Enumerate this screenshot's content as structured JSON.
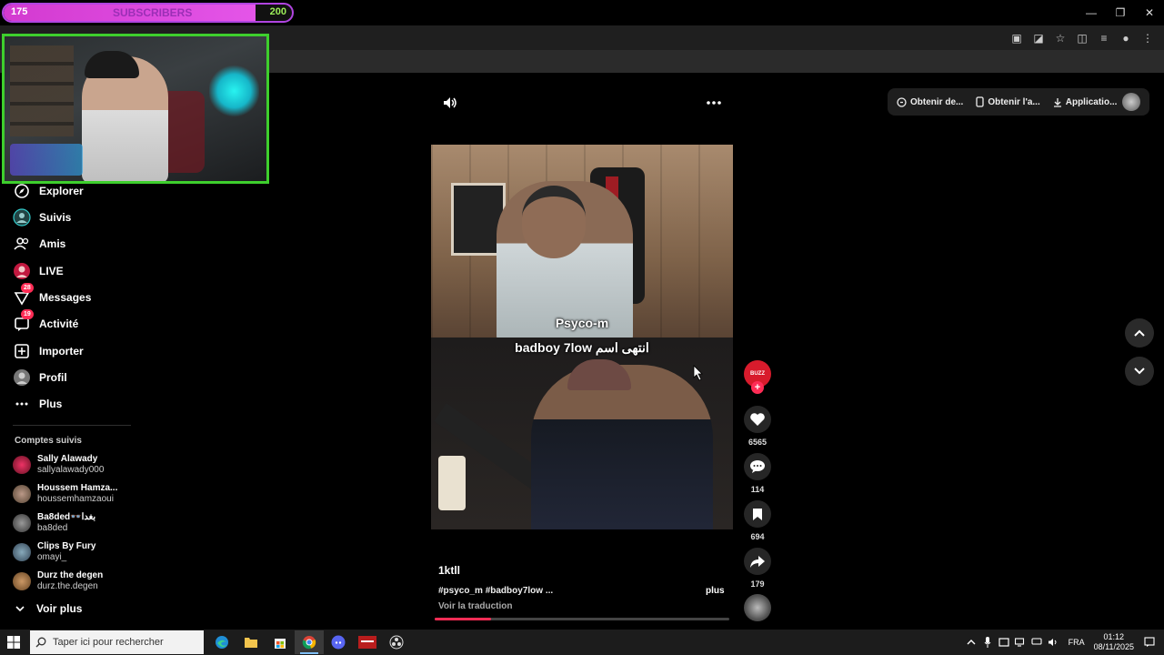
{
  "overlay": {
    "subscribers": {
      "current": "175",
      "label": "SUBSCRIBERS",
      "goal": "200",
      "progress": 0.875,
      "bar_color": "#e455e8"
    }
  },
  "sidebar": {
    "items": [
      {
        "label": "Explorer",
        "icon": "compass-icon"
      },
      {
        "label": "Suivis",
        "icon": "avatar-icon"
      },
      {
        "label": "Amis",
        "icon": "friends-icon"
      },
      {
        "label": "LIVE",
        "icon": "live-avatar-icon"
      },
      {
        "label": "Messages",
        "icon": "send-icon",
        "badge": "28"
      },
      {
        "label": "Activité",
        "icon": "inbox-icon",
        "badge": "19"
      },
      {
        "label": "Importer",
        "icon": "upload-icon"
      },
      {
        "label": "Profil",
        "icon": "profile-avatar-icon"
      },
      {
        "label": "Plus",
        "icon": "more-dots-icon"
      }
    ],
    "following_title": "Comptes suivis",
    "accounts": [
      {
        "name": "Sally Alawady",
        "handle": "sallyalawady000"
      },
      {
        "name": "Houssem Hamza...",
        "handle": "houssemhamzaoui"
      },
      {
        "name": "Ba8ded👓بغدا",
        "handle": "ba8ded"
      },
      {
        "name": "Clips By Fury",
        "handle": "omayi_"
      },
      {
        "name": "Durz the degen",
        "handle": "durz.the.degen"
      }
    ],
    "see_more": "Voir plus"
  },
  "header": {
    "actions": [
      {
        "label": "Obtenir de...",
        "icon": "coin-icon"
      },
      {
        "label": "Obtenir l'a...",
        "icon": "phone-icon"
      },
      {
        "label": "Applicatio...",
        "icon": "download-icon"
      }
    ]
  },
  "video": {
    "caption_name": "Psyco-m",
    "caption_line": "badboy 7low انتهى اسم",
    "author": "1ktll",
    "description": "#psyco_m #badboy7low ...",
    "more": "plus",
    "translate": "Voir la traduction",
    "progress": 0.19,
    "creator_avatar_text": "BUZZ"
  },
  "actions": {
    "likes": "6565",
    "comments": "114",
    "saves": "694",
    "shares": "179"
  },
  "taskbar": {
    "search_placeholder": "Taper ici pour rechercher",
    "language": "FRA",
    "time": "01:12",
    "date": "08/11/2025"
  },
  "colors": {
    "accent": "#fe2c55",
    "webcam_border": "#3ecf2d",
    "sub_border": "#b044e0"
  }
}
